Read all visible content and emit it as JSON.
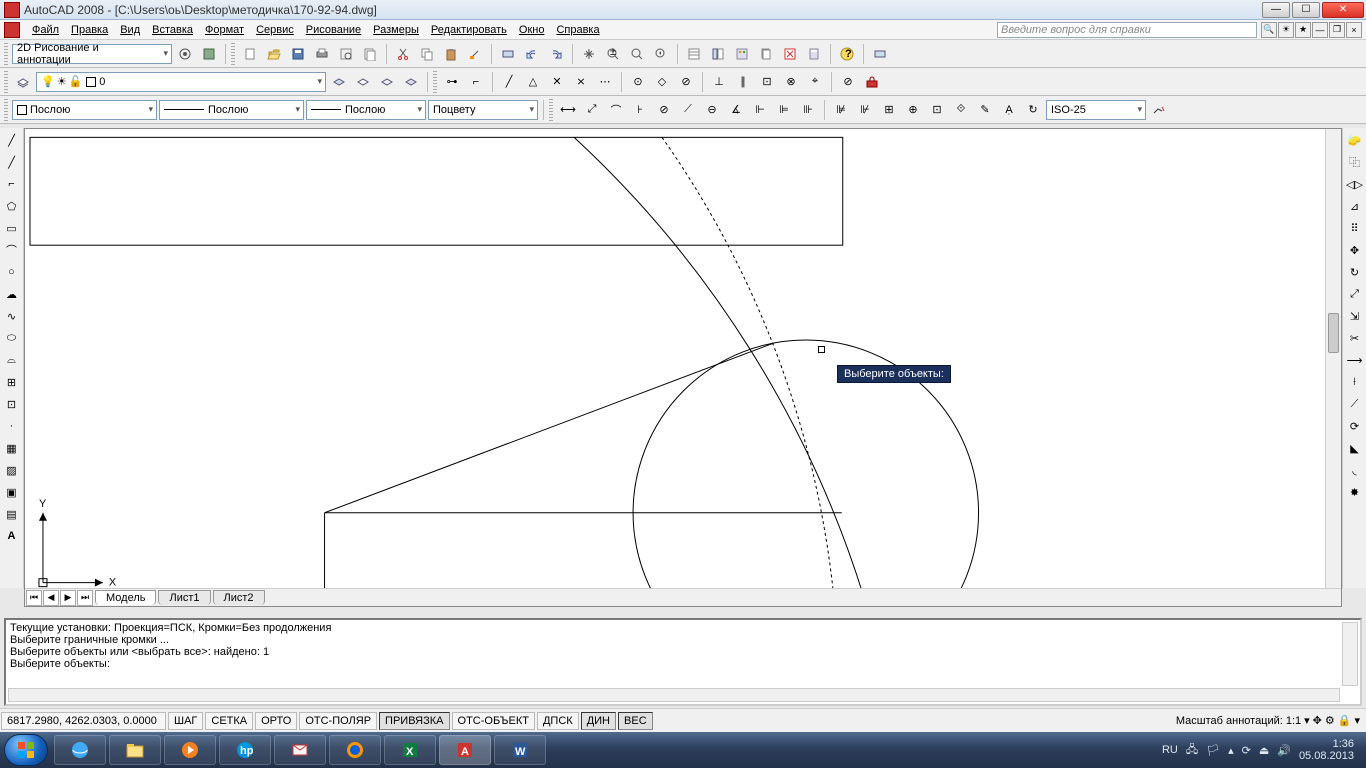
{
  "titlebar": {
    "title": "AutoCAD 2008 - [C:\\Users\\оь\\Desktop\\методичка\\170-92-94.dwg]"
  },
  "menu": [
    "Файл",
    "Правка",
    "Вид",
    "Вставка",
    "Формат",
    "Сервис",
    "Рисование",
    "Размеры",
    "Редактировать",
    "Окно",
    "Справка"
  ],
  "help_placeholder": "Введите вопрос для справки",
  "workspace": {
    "selected": "2D Рисование и аннотации"
  },
  "layer": {
    "current": "0"
  },
  "lineprops": {
    "color": "Послою",
    "linetype": "Послою",
    "lineweight": "Послою",
    "plotstyle": "Поцвету"
  },
  "dimstyle": "ISO-25",
  "sheet_tabs": {
    "tabs": [
      "Модель",
      "Лист1",
      "Лист2"
    ],
    "active": 0
  },
  "tooltip": {
    "text": "Выберите объекты:"
  },
  "commandline": {
    "lines": [
      "Текущие установки: Проекция=ПСК, Кромки=Без продолжения",
      "Выберите граничные кромки ...",
      "Выберите объекты или <выбрать все>: найдено: 1",
      " ",
      "Выберите объекты:"
    ]
  },
  "statusbar": {
    "coords": "6817.2980, 4262.0303, 0.0000",
    "toggles": [
      "ШАГ",
      "СЕТКА",
      "ОРТО",
      "ОТС-ПОЛЯР",
      "ПРИВЯЗКА",
      "ОТС-ОБЪЕКТ",
      "ДПСК",
      "ДИН",
      "ВЕС"
    ],
    "active": [
      "ПРИВЯЗКА",
      "ДИН",
      "ВЕС"
    ],
    "annoscale_label": "Масштаб аннотаций:",
    "annoscale": "1:1"
  },
  "tray": {
    "lang": "RU",
    "time": "1:36",
    "date": "05.08.2013"
  },
  "ucs": {
    "x": "X",
    "y": "Y"
  }
}
